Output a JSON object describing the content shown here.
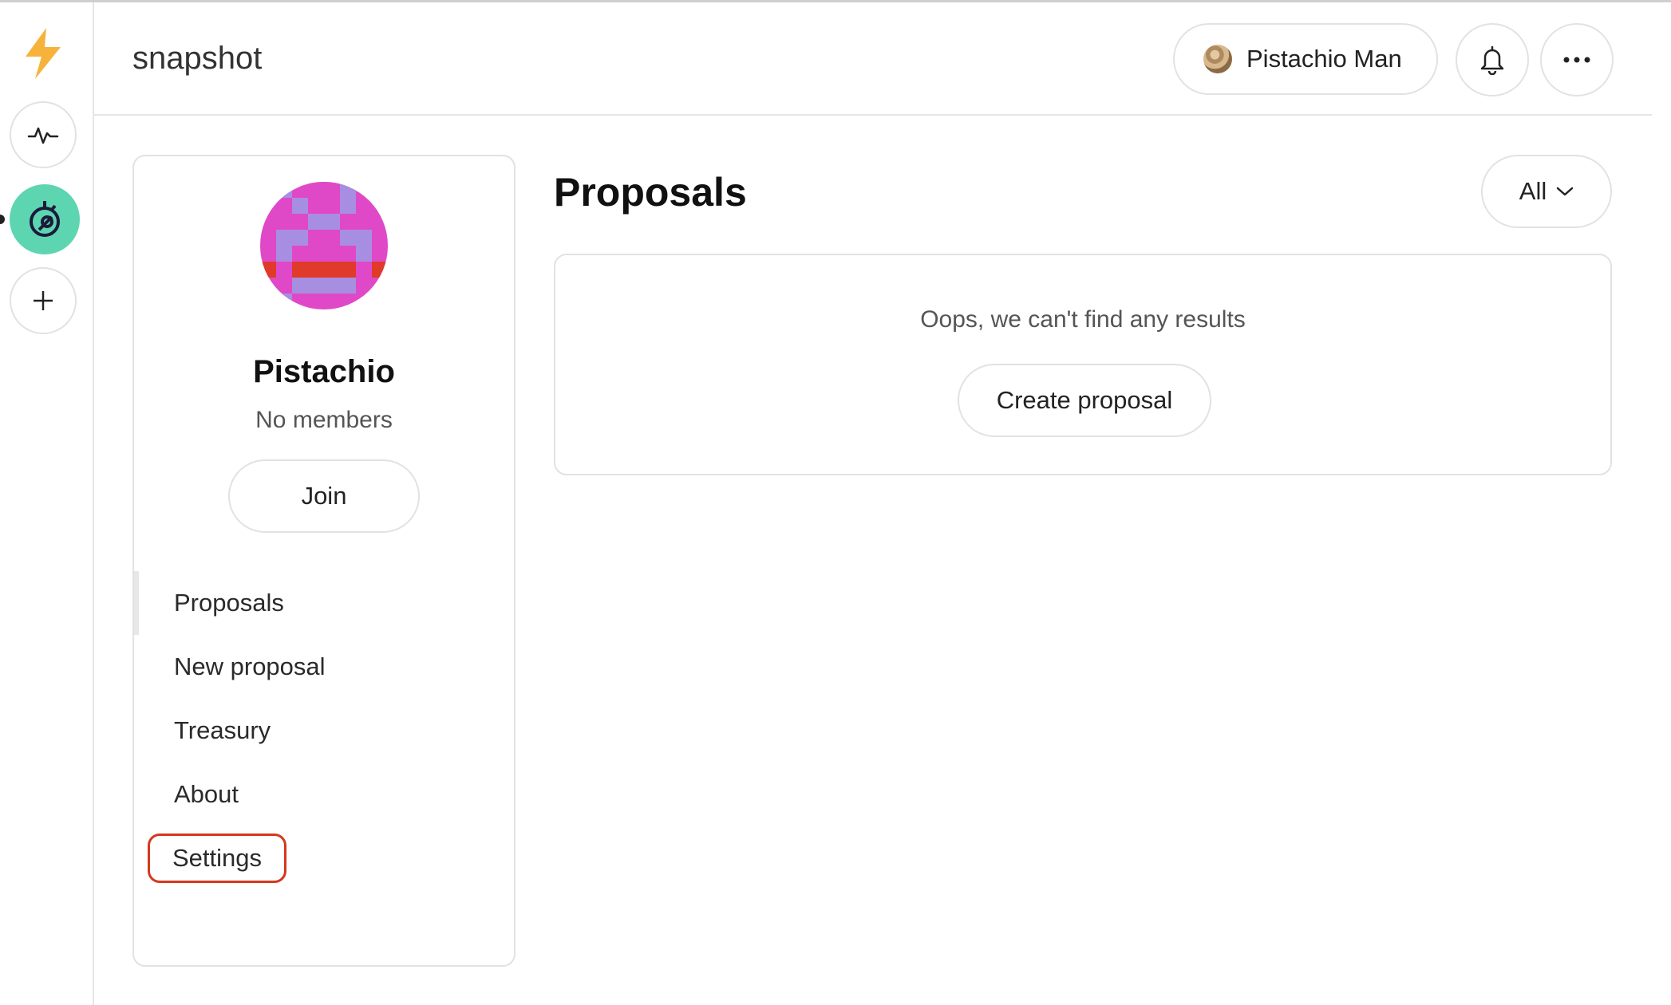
{
  "app": {
    "title": "snapshot"
  },
  "header": {
    "account_name": "Pistachio Man"
  },
  "rail": {
    "items": [
      {
        "icon": "activity-icon"
      },
      {
        "icon": "space-icon"
      },
      {
        "icon": "plus-icon"
      }
    ]
  },
  "space": {
    "name": "Pistachio",
    "members": "No members",
    "join_label": "Join",
    "nav": [
      {
        "label": "Proposals"
      },
      {
        "label": "New proposal"
      },
      {
        "label": "Treasury"
      },
      {
        "label": "About"
      },
      {
        "label": "Settings"
      }
    ]
  },
  "main": {
    "title": "Proposals",
    "filter_label": "All",
    "empty_text": "Oops, we can't find any results",
    "create_label": "Create proposal"
  },
  "colors": {
    "accent": "#5ed5b1",
    "bolt": "#f7b23b",
    "highlight": "#d3381f"
  }
}
